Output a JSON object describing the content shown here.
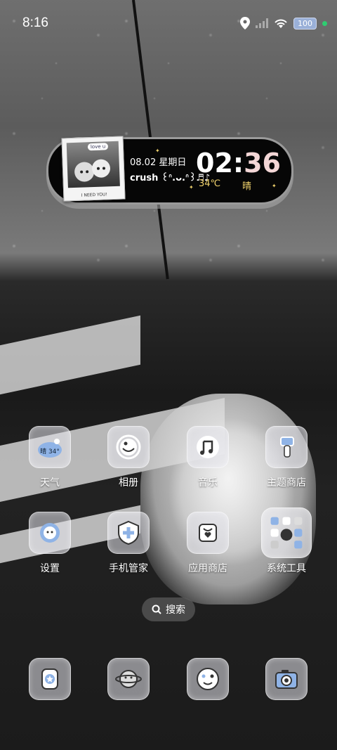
{
  "status_bar": {
    "time": "8:16",
    "battery": "100",
    "icons": [
      "location-icon",
      "signal-icon",
      "wifi-icon",
      "battery-icon",
      "status-dot"
    ]
  },
  "widget": {
    "date": "08.02 星期日",
    "crush_text": "crush ꒰ᐢ.ᴗ.ᐢ꒱♬♪",
    "clock_hour": "02:",
    "clock_minute": "36",
    "temperature": "34℃",
    "condition": "晴",
    "photo_tag": "love u",
    "photo_caption": "I NEED YOU!"
  },
  "apps": [
    {
      "label": "天气",
      "icon_text": "晴 34°",
      "icon": "weather-cloud-icon"
    },
    {
      "label": "相册",
      "icon": "gallery-face-icon"
    },
    {
      "label": "音乐",
      "icon": "music-note-icon"
    },
    {
      "label": "主题商店",
      "icon": "paint-brush-icon"
    },
    {
      "label": "设置",
      "icon": "settings-flower-icon"
    },
    {
      "label": "手机管家",
      "icon": "shield-plus-icon"
    },
    {
      "label": "应用商店",
      "icon": "shopping-bag-heart-icon"
    },
    {
      "label": "系统工具",
      "icon": "folder-icon"
    }
  ],
  "search": {
    "label": "搜索"
  },
  "dock": [
    {
      "icon": "phone-star-icon"
    },
    {
      "icon": "message-planet-icon"
    },
    {
      "icon": "browser-cat-icon"
    },
    {
      "icon": "camera-icon"
    }
  ],
  "colors": {
    "accent_yellow": "#f0d26c",
    "accent_pink": "#f3d6d6",
    "icon_blue": "#8fb3e6"
  }
}
